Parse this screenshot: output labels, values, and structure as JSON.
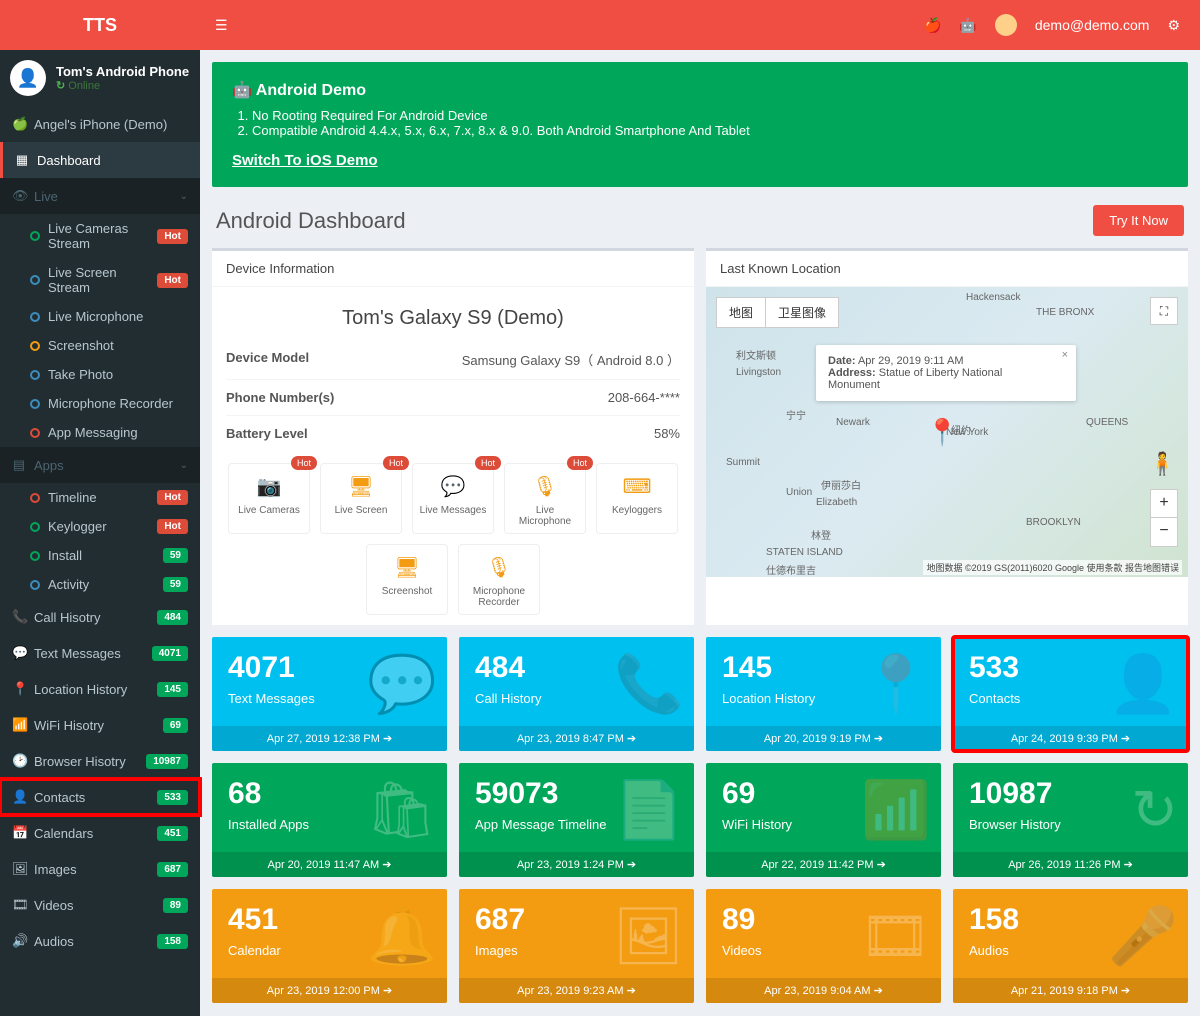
{
  "header": {
    "brand": "TTS",
    "user_email": "demo@demo.com"
  },
  "device": {
    "name": "Tom's Android Phone",
    "status": "Online"
  },
  "demo_device_label": "Angel's iPhone (Demo)",
  "nav": {
    "dashboard": "Dashboard",
    "live": "Live",
    "live_items": [
      {
        "label": "Live Cameras Stream",
        "badge": "Hot",
        "badge_cls": "bg-red",
        "bullet": "b-green"
      },
      {
        "label": "Live Screen Stream",
        "badge": "Hot",
        "badge_cls": "bg-red",
        "bullet": "b-blue"
      },
      {
        "label": "Live Microphone",
        "bullet": "b-blue"
      },
      {
        "label": "Screenshot",
        "bullet": "b-orange"
      },
      {
        "label": "Take Photo",
        "bullet": "b-blue"
      },
      {
        "label": "Microphone Recorder",
        "bullet": "b-blue"
      },
      {
        "label": "App Messaging",
        "bullet": "b-red"
      }
    ],
    "apps": "Apps",
    "apps_items": [
      {
        "label": "Timeline",
        "badge": "Hot",
        "badge_cls": "bg-red",
        "bullet": "b-red"
      },
      {
        "label": "Keylogger",
        "badge": "Hot",
        "badge_cls": "bg-red",
        "bullet": "b-green"
      },
      {
        "label": "Install",
        "badge": "59",
        "badge_cls": "bg-green",
        "bullet": "b-green"
      },
      {
        "label": "Activity",
        "badge": "59",
        "badge_cls": "bg-green",
        "bullet": "b-blue"
      }
    ],
    "main_items": [
      {
        "label": "Call Hisotry",
        "badge": "484",
        "badge_cls": "bg-green",
        "icon": "📞"
      },
      {
        "label": "Text Messages",
        "badge": "4071",
        "badge_cls": "bg-green",
        "icon": "💬"
      },
      {
        "label": "Location History",
        "badge": "145",
        "badge_cls": "bg-green",
        "icon": "📍"
      },
      {
        "label": "WiFi Hisotry",
        "badge": "69",
        "badge_cls": "bg-green",
        "icon": "📶"
      },
      {
        "label": "Browser Hisotry",
        "badge": "10987",
        "badge_cls": "bg-green",
        "icon": "🕑"
      },
      {
        "label": "Contacts",
        "badge": "533",
        "badge_cls": "bg-green",
        "icon": "👤",
        "highlight": true
      },
      {
        "label": "Calendars",
        "badge": "451",
        "badge_cls": "bg-green",
        "icon": "📅"
      },
      {
        "label": "Images",
        "badge": "687",
        "badge_cls": "bg-green",
        "icon": "🖼"
      },
      {
        "label": "Videos",
        "badge": "89",
        "badge_cls": "bg-green",
        "icon": "🎞"
      },
      {
        "label": "Audios",
        "badge": "158",
        "badge_cls": "bg-green",
        "icon": "🔊"
      }
    ]
  },
  "banner": {
    "title": "Android Demo",
    "lines": [
      "No Rooting Required For Android Device",
      "Compatible Android 4.4.x, 5.x, 6.x, 7.x, 8.x & 9.0. Both Android Smartphone And Tablet"
    ],
    "link": "Switch To iOS Demo"
  },
  "page": {
    "title": "Android Dashboard",
    "try_btn": "Try It Now"
  },
  "device_info": {
    "box_title": "Device Information",
    "title": "Tom's Galaxy S9 (Demo)",
    "rows": [
      {
        "k": "Device Model",
        "v": "Samsung Galaxy S9（ Android 8.0 ）"
      },
      {
        "k": "Phone Number(s)",
        "v": "208-664-****"
      },
      {
        "k": "Battery Level",
        "v": "58%"
      }
    ],
    "quick": [
      {
        "label": "Live Cameras",
        "icon": "📷",
        "hot": true
      },
      {
        "label": "Live Screen",
        "icon": "🖥",
        "hot": true
      },
      {
        "label": "Live Messages",
        "icon": "💬",
        "hot": true
      },
      {
        "label": "Live Microphone",
        "icon": "🎙",
        "hot": true
      },
      {
        "label": "Keyloggers",
        "icon": "⌨"
      },
      {
        "label": "Screenshot",
        "icon": "🖥"
      },
      {
        "label": "Microphone Recorder",
        "icon": "🎙"
      }
    ]
  },
  "map": {
    "box_title": "Last Known Location",
    "toggle_map": "地图",
    "toggle_sat": "卫星图像",
    "date_label": "Date:",
    "date": "Apr 29, 2019 9:11 AM",
    "addr_label": "Address:",
    "addr": "Statue of Liberty National Monument",
    "attribution": "地图数据 ©2019 GS(2011)6020 Google  使用条款  报告地图错误",
    "labels": [
      "Hackensack",
      "THE BRONX",
      "Livingston",
      "Newark",
      "New York",
      "Summit",
      "Union",
      "Elizabeth",
      "BROOKLYN",
      "QUEENS",
      "STATEN ISLAND",
      "伊丽莎白",
      "林登",
      "纽约",
      "宁宁",
      "仕德布里吉",
      "利文斯顿"
    ]
  },
  "stats": [
    {
      "num": "4071",
      "lbl": "Text Messages",
      "foot": "Apr 27, 2019 12:38 PM",
      "cls": "s-blue",
      "icon": "💬"
    },
    {
      "num": "484",
      "lbl": "Call History",
      "foot": "Apr 23, 2019 8:47 PM",
      "cls": "s-blue",
      "icon": "📞"
    },
    {
      "num": "145",
      "lbl": "Location History",
      "foot": "Apr 20, 2019 9:19 PM",
      "cls": "s-blue",
      "icon": "📍"
    },
    {
      "num": "533",
      "lbl": "Contacts",
      "foot": "Apr 24, 2019 9:39 PM",
      "cls": "s-blue",
      "icon": "👤",
      "highlight": true
    },
    {
      "num": "68",
      "lbl": "Installed Apps",
      "foot": "Apr 20, 2019 11:47 AM",
      "cls": "s-green",
      "icon": "🛍"
    },
    {
      "num": "59073",
      "lbl": "App Message Timeline",
      "foot": "Apr 23, 2019 1:24 PM",
      "cls": "s-green",
      "icon": "📄"
    },
    {
      "num": "69",
      "lbl": "WiFi History",
      "foot": "Apr 22, 2019 11:42 PM",
      "cls": "s-green",
      "icon": "📶"
    },
    {
      "num": "10987",
      "lbl": "Browser History",
      "foot": "Apr 26, 2019 11:26 PM",
      "cls": "s-green",
      "icon": "↻"
    },
    {
      "num": "451",
      "lbl": "Calendar",
      "foot": "Apr 23, 2019 12:00 PM",
      "cls": "s-orange",
      "icon": "🔔"
    },
    {
      "num": "687",
      "lbl": "Images",
      "foot": "Apr 23, 2019 9:23 AM",
      "cls": "s-orange",
      "icon": "🖼"
    },
    {
      "num": "89",
      "lbl": "Videos",
      "foot": "Apr 23, 2019 9:04 AM",
      "cls": "s-orange",
      "icon": "🎞"
    },
    {
      "num": "158",
      "lbl": "Audios",
      "foot": "Apr 21, 2019 9:18 PM",
      "cls": "s-orange",
      "icon": "🎤"
    }
  ]
}
